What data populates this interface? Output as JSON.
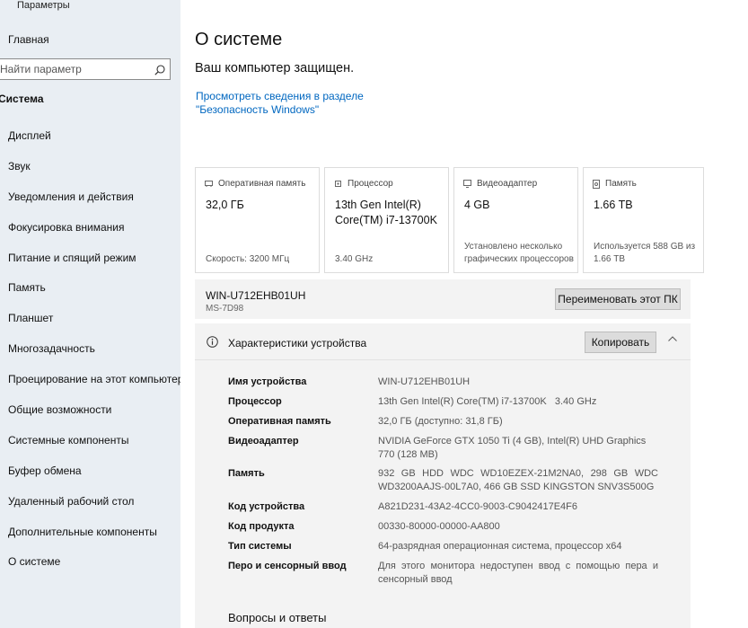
{
  "window": {
    "title": "Параметры"
  },
  "sidebar": {
    "home": "Главная",
    "search_placeholder": "Найти параметр",
    "section": "Система",
    "items": [
      "Дисплей",
      "Звук",
      "Уведомления и действия",
      "Фокусировка внимания",
      "Питание и спящий режим",
      "Память",
      "Планшет",
      "Многозадачность",
      "Проецирование на этот компьютер",
      "Общие возможности",
      "Системные компоненты",
      "Буфер обмена",
      "Удаленный рабочий стол",
      "Дополнительные компоненты",
      "О системе"
    ]
  },
  "main": {
    "title": "О системе",
    "protected": "Ваш компьютер защищен.",
    "security_link": "Просмотреть сведения в разделе \"Безопасность Windows\"",
    "cards": [
      {
        "icon": "ram-icon",
        "label": "Оперативная память",
        "value": "32,0 ГБ",
        "sub": "Скорость: 3200 МГц"
      },
      {
        "icon": "cpu-icon",
        "label": "Процессор",
        "value": "13th Gen Intel(R) Core(TM) i7-13700K",
        "sub": "3.40 GHz"
      },
      {
        "icon": "gpu-icon",
        "label": "Видеоадаптер",
        "value": "4 GB",
        "sub": "Установлено несколько графических процессоров"
      },
      {
        "icon": "storage-icon",
        "label": "Память",
        "value": "1.66 TB",
        "sub": "Используется 588 GB из 1.66 TB"
      }
    ],
    "pc_name": "WIN-U712EHB01UH",
    "pc_model": "MS-7D98",
    "rename_label": "Переименовать этот ПК",
    "specs_title": "Характеристики устройства",
    "copy_label": "Копировать",
    "specs": [
      {
        "key": "Имя устройства",
        "value": "WIN-U712EHB01UH"
      },
      {
        "key": "Процессор",
        "value": "13th Gen Intel(R) Core(TM) i7-13700K   3.40 GHz"
      },
      {
        "key": "Оперативная память",
        "value": "32,0 ГБ (доступно: 31,8 ГБ)"
      },
      {
        "key": "Видеоадаптер",
        "value": "NVIDIA GeForce GTX 1050 Ti (4 GB), Intel(R) UHD Graphics 770 (128 MB)"
      },
      {
        "key": "Память",
        "value": "932 GB HDD WDC WD10EZEX-21M2NA0, 298 GB WDC WD3200AAJS-00L7A0, 466 GB SSD KINGSTON SNV3S500G"
      },
      {
        "key": "Код устройства",
        "value": "A821D231-43A2-4CC0-9003-C9042417E4F6"
      },
      {
        "key": "Код продукта",
        "value": "00330-80000-00000-AA800"
      },
      {
        "key": "Тип системы",
        "value": "64-разрядная операционная система, процессор x64"
      },
      {
        "key": "Перо и сенсорный ввод",
        "value": "Для этого монитора недоступен ввод с помощью пера и сенсорный ввод"
      }
    ],
    "faq_title": "Вопросы и ответы"
  }
}
